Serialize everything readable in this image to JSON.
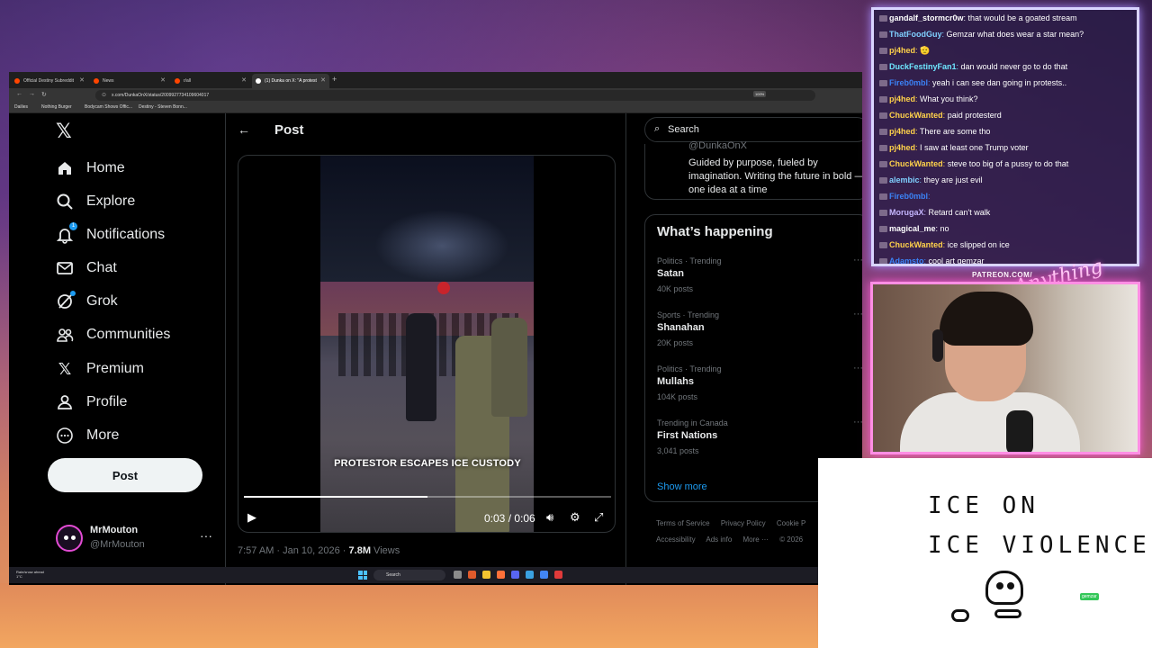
{
  "browser": {
    "tabs": [
      {
        "label": "Official Destiny Subreddit"
      },
      {
        "label": "News"
      },
      {
        "label": "r/all"
      },
      {
        "label": "(1) Dunka on X: \"A protest"
      }
    ],
    "url": "x.com/DunkaOnX/status/2009927734109604017",
    "zoom": "100%",
    "bookmarks": [
      "Dailies",
      "Nothing Burger",
      "Bodycam Shows Offic...",
      "Destiny - Steven Bonn..."
    ]
  },
  "sidebar": {
    "items": [
      {
        "label": "Home"
      },
      {
        "label": "Explore"
      },
      {
        "label": "Notifications",
        "badge": "1"
      },
      {
        "label": "Chat"
      },
      {
        "label": "Grok"
      },
      {
        "label": "Communities"
      },
      {
        "label": "Premium"
      },
      {
        "label": "Profile"
      },
      {
        "label": "More"
      }
    ],
    "post_button": "Post",
    "account": {
      "name": "MrMouton",
      "handle": "@MrMouton"
    }
  },
  "main": {
    "title": "Post",
    "video": {
      "caption": "PROTESTOR ESCAPES ICE CUSTODY",
      "time": "0:03 / 0:06",
      "progress": 0.5
    },
    "meta": {
      "time": "7:57 AM · Jan 10, 2026 · ",
      "views_num": "7.8M",
      "views_label": " Views"
    }
  },
  "right": {
    "search_placeholder": "Search",
    "profile_card": {
      "handle": "@DunkaOnX",
      "bio": "Guided by purpose, fueled by imagination. Writing the future in bold — one idea at a time"
    },
    "trends_title": "What’s happening",
    "trends": [
      {
        "category": "Politics · Trending",
        "name": "Satan",
        "count": "40K posts"
      },
      {
        "category": "Sports · Trending",
        "name": "Shanahan",
        "count": "20K posts"
      },
      {
        "category": "Politics · Trending",
        "name": "Mullahs",
        "count": "104K posts"
      },
      {
        "category": "Trending in Canada",
        "name": "First Nations",
        "count": "3,041 posts"
      }
    ],
    "show_more": "Show more",
    "footer": [
      "Terms of Service",
      "Privacy Policy",
      "Cookie P",
      "Accessibility",
      "Ads info",
      "More ···",
      "© 2026"
    ]
  },
  "taskbar": {
    "weather": "Rain/snow ahead",
    "temp": "1°C",
    "search": "Search"
  },
  "chat": {
    "messages": [
      {
        "user": "gandalf_stormcr0w",
        "text": " that would be a goated stream",
        "color": "#ffffff"
      },
      {
        "user": "ThatFoodGuy",
        "text": " Gemzar what does wear a star mean?",
        "color": "#7fd0ff"
      },
      {
        "user": "pj4hed",
        "text": " 🫡",
        "color": "#ffd24a"
      },
      {
        "user": "DuckFestinyFan1",
        "text": " dan would never go to do that",
        "color": "#6ee7ff"
      },
      {
        "user": "Fireb0mbl",
        "text": " yeah i can see dan going in protests..",
        "color": "#3b82f6"
      },
      {
        "user": "pj4hed",
        "text": " What you think?",
        "color": "#ffd24a"
      },
      {
        "user": "ChuckWanted",
        "text": " paid protesterd",
        "color": "#ffd24a"
      },
      {
        "user": "pj4hed",
        "text": " There are some tho",
        "color": "#ffd24a"
      },
      {
        "user": "pj4hed",
        "text": " I saw at least one Trump voter",
        "color": "#ffd24a"
      },
      {
        "user": "ChuckWanted",
        "text": " steve too big of a pussy to do that",
        "color": "#ffd24a"
      },
      {
        "user": "alembic",
        "text": " they are just evil",
        "color": "#7fd0ff"
      },
      {
        "user": "Fireb0mbl",
        "text": " ",
        "color": "#3b82f6"
      },
      {
        "user": "MorugaX",
        "text": " Retard can't walk",
        "color": "#c4b5fd"
      },
      {
        "user": "magical_me",
        "text": " no",
        "color": "#ffffff"
      },
      {
        "user": "ChuckWanted",
        "text": " ice slipped on ice",
        "color": "#ffd24a"
      },
      {
        "user": "Adamsto",
        "text": " cool art gemzar",
        "color": "#3b82f6"
      }
    ]
  },
  "overlay": {
    "patreon": "PATREON.COM/",
    "anything": "Anything Else?"
  },
  "drawing": {
    "line1": "ICE ON",
    "line2": "ICE VIOLENCE",
    "tag": "gemzar"
  }
}
